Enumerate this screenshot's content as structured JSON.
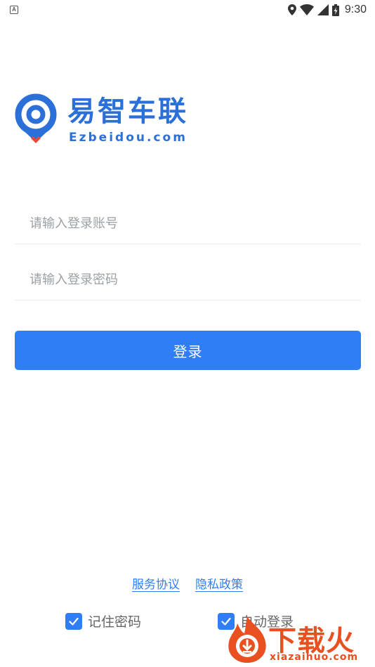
{
  "status_bar": {
    "notification_icon_letter": "A",
    "time": "9:30",
    "icons": [
      "location-icon",
      "wifi-icon",
      "signal-icon",
      "battery-charging-icon"
    ]
  },
  "logo": {
    "name": "易智车联",
    "domain": "Ezbeidou.com",
    "colors": {
      "blue": "#2b6fd8",
      "red": "#e8483a"
    }
  },
  "form": {
    "account_placeholder": "请输入登录账号",
    "password_placeholder": "请输入登录密码",
    "login_label": "登录"
  },
  "links": {
    "service_agreement": "服务协议",
    "privacy_policy": "隐私政策"
  },
  "options": {
    "remember_password": {
      "label": "记住密码",
      "checked": true
    },
    "auto_login": {
      "label": "自动登录",
      "checked": true
    }
  },
  "watermark": {
    "text": "下载火",
    "domain": "xiazaihuo.com"
  },
  "theme": {
    "primary": "#2f7ef6",
    "placeholder": "#9aa0a6",
    "divider": "#ececec",
    "watermark": "#e8501f"
  }
}
